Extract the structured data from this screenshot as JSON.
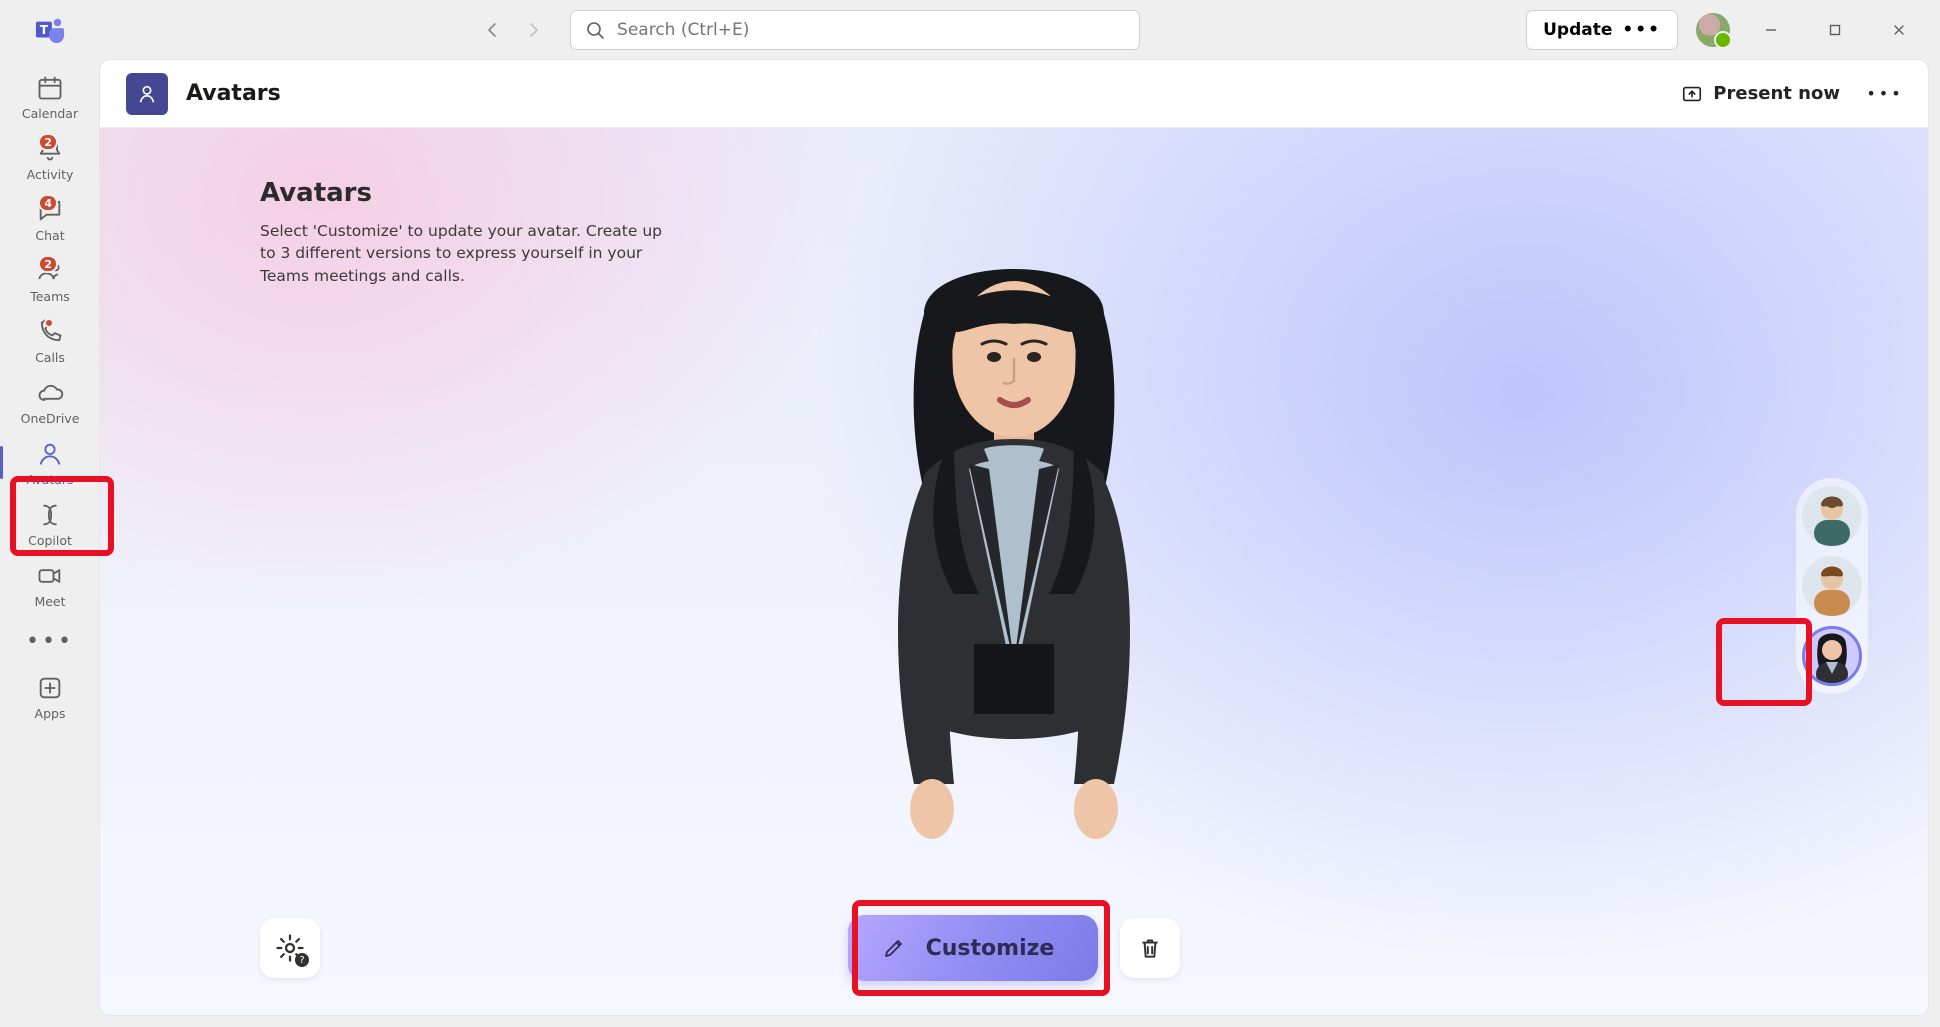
{
  "titlebar": {
    "search_placeholder": "Search (Ctrl+E)",
    "update_label": "Update"
  },
  "rail": {
    "items": [
      {
        "id": "calendar",
        "label": "Calendar"
      },
      {
        "id": "activity",
        "label": "Activity",
        "badge": "2"
      },
      {
        "id": "chat",
        "label": "Chat",
        "badge": "4"
      },
      {
        "id": "teams",
        "label": "Teams",
        "badge": "2"
      },
      {
        "id": "calls",
        "label": "Calls",
        "dot": true
      },
      {
        "id": "onedrive",
        "label": "OneDrive"
      },
      {
        "id": "avatars",
        "label": "Avatars",
        "selected": true
      },
      {
        "id": "copilot",
        "label": "Copilot"
      },
      {
        "id": "meet",
        "label": "Meet"
      }
    ],
    "apps_label": "Apps"
  },
  "header": {
    "app_title": "Avatars",
    "present_label": "Present now"
  },
  "content": {
    "heading": "Avatars",
    "body": "Select 'Customize' to update your avatar. Create up to 3 different versions to express yourself in your Teams meetings and calls."
  },
  "actions": {
    "customize_label": "Customize"
  },
  "picker": {
    "slots": [
      {
        "id": "avatar-1",
        "selected": false
      },
      {
        "id": "avatar-2",
        "selected": false
      },
      {
        "id": "avatar-3",
        "selected": true
      }
    ]
  }
}
